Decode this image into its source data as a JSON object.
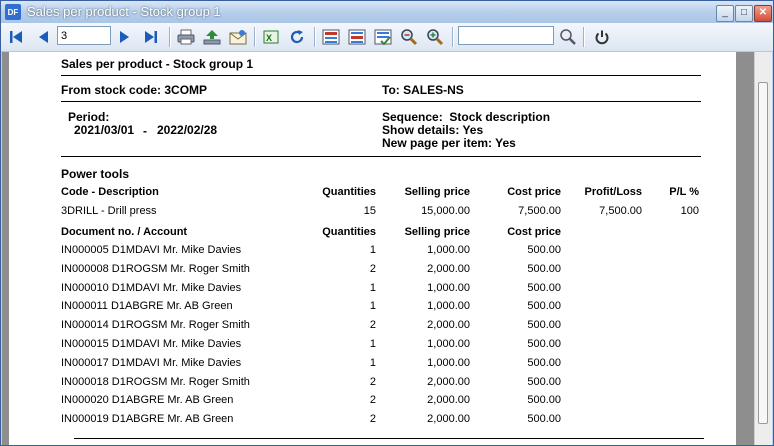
{
  "window": {
    "title": "Sales per product - Stock group 1",
    "icon_label": "DF",
    "minimize": "_",
    "maximize": "□",
    "close": "✕"
  },
  "toolbar": {
    "page_value": "3",
    "search_value": ""
  },
  "report": {
    "title": "Sales per product - Stock group 1",
    "from_label": "From stock code:",
    "from_value": "3COMP",
    "to_label": "To:",
    "to_value": "SALES-NS",
    "period_label": "Period:",
    "period_from": "2021/03/01",
    "period_dash": "-",
    "period_to": "2022/02/28",
    "sequence_label": "Sequence:",
    "sequence_value": "Stock description",
    "show_details_label": "Show details:",
    "show_details_value": "Yes",
    "new_page_label": "New page per item:",
    "new_page_value": "Yes",
    "group_title": "Power tools",
    "header1": {
      "code_desc": "Code - Description",
      "quantities": "Quantities",
      "selling_price": "Selling price",
      "cost_price": "Cost price",
      "profit_loss": "Profit/Loss",
      "pl_pct": "P/L  %"
    },
    "item": {
      "code_desc": "3DRILL - Drill press",
      "quantities": "15",
      "selling_price": "15,000.00",
      "cost_price": "7,500.00",
      "profit_loss": "7,500.00",
      "pl_pct": "100"
    },
    "header2": {
      "doc_account": "Document no. / Account",
      "quantities": "Quantities",
      "selling_price": "Selling price",
      "cost_price": "Cost price"
    },
    "rows": [
      {
        "doc": "IN000005  D1MDAVI Mr. Mike Davies",
        "qty": "1",
        "sell": "1,000.00",
        "cost": "500.00"
      },
      {
        "doc": "IN000008  D1ROGSM Mr. Roger Smith",
        "qty": "2",
        "sell": "2,000.00",
        "cost": "500.00"
      },
      {
        "doc": "IN000010  D1MDAVI Mr. Mike Davies",
        "qty": "1",
        "sell": "1,000.00",
        "cost": "500.00"
      },
      {
        "doc": "IN000011  D1ABGRE Mr. AB Green",
        "qty": "1",
        "sell": "1,000.00",
        "cost": "500.00"
      },
      {
        "doc": "IN000014  D1ROGSM Mr. Roger Smith",
        "qty": "2",
        "sell": "2,000.00",
        "cost": "500.00"
      },
      {
        "doc": "IN000015  D1MDAVI Mr. Mike Davies",
        "qty": "1",
        "sell": "1,000.00",
        "cost": "500.00"
      },
      {
        "doc": "IN000017  D1MDAVI Mr. Mike Davies",
        "qty": "1",
        "sell": "1,000.00",
        "cost": "500.00"
      },
      {
        "doc": "IN000018  D1ROGSM Mr. Roger Smith",
        "qty": "2",
        "sell": "2,000.00",
        "cost": "500.00"
      },
      {
        "doc": "IN000020  D1ABGRE Mr. AB Green",
        "qty": "2",
        "sell": "2,000.00",
        "cost": "500.00"
      },
      {
        "doc": "IN000019  D1ABGRE Mr. AB Green",
        "qty": "2",
        "sell": "2,000.00",
        "cost": "500.00"
      }
    ]
  },
  "icons": [
    "first-page-icon",
    "prev-page-icon",
    "next-page-icon",
    "last-page-icon",
    "print-icon",
    "export-icon",
    "email-icon",
    "export-excel-icon",
    "refresh-icon",
    "layout-1-icon",
    "layout-2-icon",
    "layout-3-icon",
    "zoom-out-icon",
    "zoom-in-icon",
    "search-icon",
    "close-report-icon"
  ]
}
